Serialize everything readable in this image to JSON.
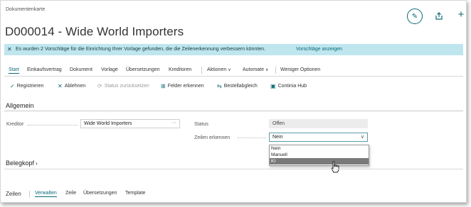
{
  "header": {
    "breadcrumb": "Dokumentenkarte",
    "title": "D000014 - Wide World Importers"
  },
  "banner": {
    "close": "✕",
    "message": "Es wurden 2 Vorschläge für die Einrichtung Ihrer Vorlage gefunden, die die Zeilenerkennung verbessern könnten.",
    "link": "Vorschläge anzeigen"
  },
  "nav": {
    "items": [
      "Start",
      "Einkaufsvertrag",
      "Dokument",
      "Vorlage",
      "Übersetzungen",
      "Kreditoren",
      "Aktionen",
      "Automate",
      "Weniger Optionen"
    ]
  },
  "actions": {
    "items": [
      "Registrieren",
      "Ablehnen",
      "Status zurücksetzen",
      "Felder erkennen",
      "Bestellabgleich",
      "Continia Hub"
    ]
  },
  "general": {
    "heading": "Allgemein",
    "creditor_label": "Kreditor",
    "creditor_value": "Wide World Importers",
    "status_label": "Status",
    "status_value": "Offen",
    "lines_label": "Zeilen erkennen",
    "lines_value": "Nein",
    "options": [
      "Nein",
      "Manuell",
      "KI"
    ]
  },
  "belegkopf": {
    "heading": "Belegkopf"
  },
  "lines": {
    "heading": "Zeilen",
    "tabs": [
      "Verwalten",
      "Zeile",
      "Übersetzungen",
      "Template"
    ]
  }
}
